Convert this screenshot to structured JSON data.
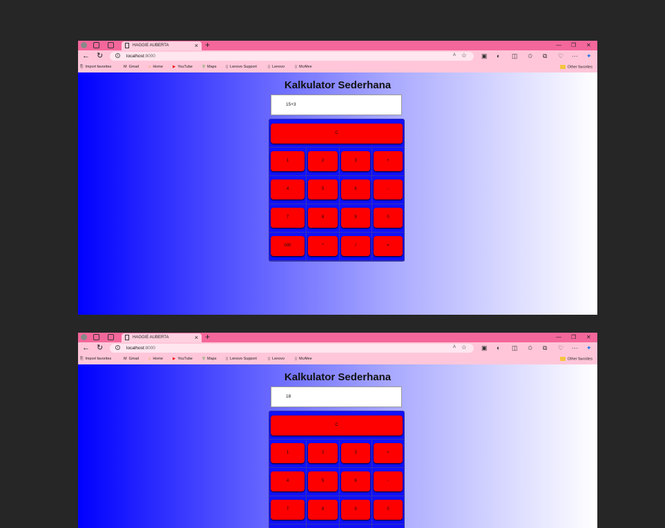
{
  "browser": {
    "tab_title": "HAGGIE AUBERTA",
    "tab_close": "×",
    "new_tab": "+",
    "window_controls": {
      "minimize": "—",
      "restore": "❐",
      "close": "✕"
    },
    "nav": {
      "back": "←",
      "reload": "↻"
    },
    "url_host": "localhost",
    "url_port": ":8000",
    "read_aloud": "A",
    "favorite_star": "☆",
    "toolbar_icons": [
      "extension-icon",
      "copilot-circle-icon",
      "split-screen-icon",
      "favorites-icon",
      "collections-icon",
      "browser-essentials-icon",
      "more-icon",
      "copilot-icon"
    ],
    "toolbar_glyphs": [
      "▣",
      "◐",
      "◫",
      "✩",
      "⧉",
      "♡",
      "···",
      "✦"
    ],
    "more_label": "···",
    "bookmarks": [
      {
        "label": "Import favorites",
        "icon": "import-icon"
      },
      {
        "label": "Gmail",
        "icon": "gmail-icon"
      },
      {
        "label": "Home",
        "icon": "home-icon"
      },
      {
        "label": "YouTube",
        "icon": "youtube-icon"
      },
      {
        "label": "Maps",
        "icon": "maps-pin-icon"
      },
      {
        "label": "Lenovo Support",
        "icon": "page-icon"
      },
      {
        "label": "Lenovo",
        "icon": "page-icon"
      },
      {
        "label": "McAfee",
        "icon": "page-icon"
      }
    ],
    "other_favorites": "Other favorites"
  },
  "calculator": {
    "title": "Kalkulator Sederhana",
    "clear_label": "C",
    "buttons": [
      "1",
      "2",
      "3",
      "+",
      "4",
      "5",
      "6",
      "-",
      "7",
      "8",
      "9",
      "0",
      "000",
      "*",
      "/",
      "="
    ]
  },
  "windows": [
    {
      "display": "15+3"
    },
    {
      "display": "18"
    }
  ],
  "colors": {
    "tab_bar": "#f4679a",
    "address_bar": "#ffc6d9",
    "button_red": "#ff0000",
    "pad_blue": "#1010ff",
    "gradient_start": "#0000ff",
    "gradient_end": "#ffffff"
  }
}
